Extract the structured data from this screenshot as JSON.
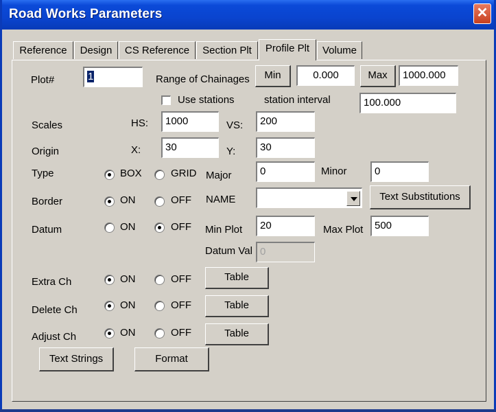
{
  "window": {
    "title": "Road Works Parameters",
    "close_glyph": "✕"
  },
  "tabs": [
    {
      "label": "Reference"
    },
    {
      "label": "Design"
    },
    {
      "label": "CS Reference"
    },
    {
      "label": "Section Plt"
    },
    {
      "label": "Profile Plt",
      "active": true
    },
    {
      "label": "Volume"
    }
  ],
  "plot": {
    "label": "Plot#",
    "value": "1"
  },
  "range": {
    "label": "Range of Chainages",
    "min_label": "Min",
    "min_value": "0.000",
    "max_label": "Max",
    "max_value": "1000.000"
  },
  "stations": {
    "checkbox_label": "Use stations",
    "interval_label": "station interval",
    "interval_value": "100.000"
  },
  "scales": {
    "label": "Scales",
    "hs_label": "HS:",
    "hs_value": "1000",
    "vs_label": "VS:",
    "vs_value": "200"
  },
  "origin": {
    "label": "Origin",
    "x_label": "X:",
    "x_value": "30",
    "y_label": "Y:",
    "y_value": "30"
  },
  "type": {
    "label": "Type",
    "opt1": "BOX",
    "opt2": "GRID",
    "selected": "BOX",
    "major_label": "Major",
    "major_value": "0",
    "minor_label": "Minor",
    "minor_value": "0"
  },
  "border": {
    "label": "Border",
    "opt1": "ON",
    "opt2": "OFF",
    "selected": "ON",
    "name_label": "NAME",
    "name_value": "",
    "text_subs_button": "Text Substitutions"
  },
  "datum": {
    "label": "Datum",
    "opt1": "ON",
    "opt2": "OFF",
    "selected": "OFF",
    "min_plot_label": "Min Plot",
    "min_plot_value": "20",
    "max_plot_label": "Max Plot",
    "max_plot_value": "500",
    "datum_val_label": "Datum Val",
    "datum_val_value": "0"
  },
  "extra_ch": {
    "label": "Extra Ch",
    "opt1": "ON",
    "opt2": "OFF",
    "selected": "ON",
    "button": "Table"
  },
  "delete_ch": {
    "label": "Delete Ch",
    "opt1": "ON",
    "opt2": "OFF",
    "selected": "ON",
    "button": "Table"
  },
  "adjust_ch": {
    "label": "Adjust Ch",
    "opt1": "ON",
    "opt2": "OFF",
    "selected": "ON",
    "button": "Table"
  },
  "footer": {
    "text_strings_button": "Text Strings",
    "format_button": "Format"
  },
  "colors": {
    "titlebar": "#0b4ad8",
    "dialog": "#d4d0c8",
    "selection": "#0a246a"
  }
}
